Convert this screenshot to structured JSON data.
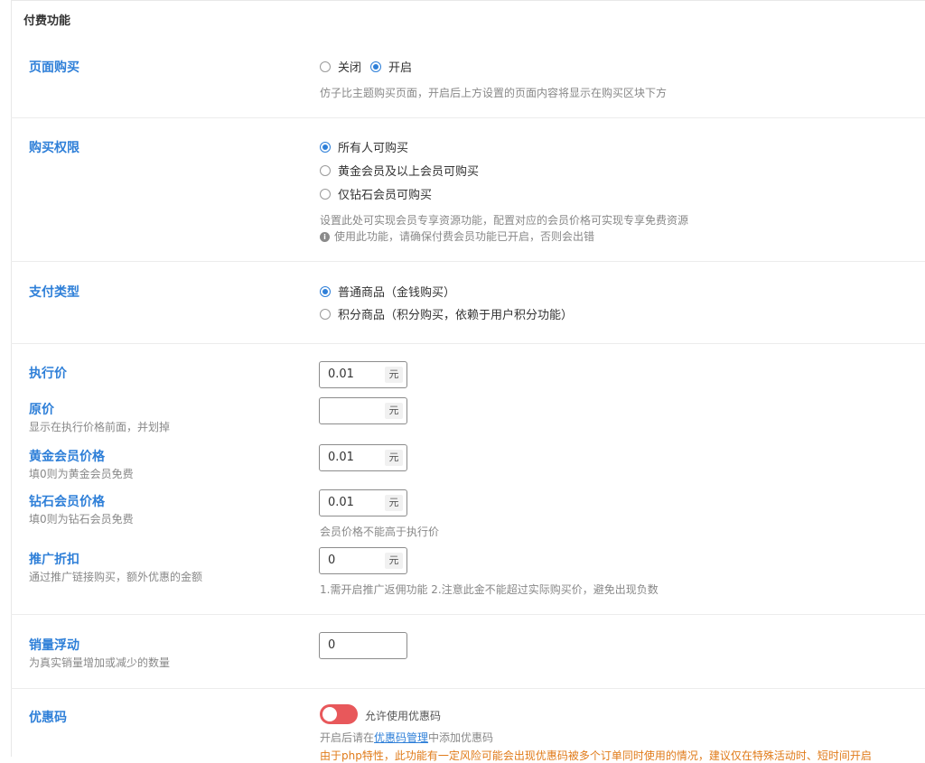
{
  "section_title": "付费功能",
  "page_purchase": {
    "label": "页面购买",
    "options": [
      "关闭",
      "开启"
    ],
    "selected": 1,
    "help": "仿子比主题购买页面，开启后上方设置的页面内容将显示在购买区块下方"
  },
  "purchase_permission": {
    "label": "购买权限",
    "options": [
      "所有人可购买",
      "黄金会员及以上会员可购买",
      "仅钻石会员可购买"
    ],
    "selected": 0,
    "help": "设置此处可实现会员专享资源功能，配置对应的会员价格可实现专享免费资源",
    "notice_icon": "info-icon",
    "notice": "使用此功能，请确保付费会员功能已开启，否则会出错"
  },
  "pay_type": {
    "label": "支付类型",
    "options": [
      "普通商品（金钱购买）",
      "积分商品（积分购买，依赖于用户积分功能）"
    ],
    "selected": 0
  },
  "price": {
    "label": "执行价",
    "value": "0.01",
    "unit": "元"
  },
  "original_price": {
    "label": "原价",
    "desc": "显示在执行价格前面，并划掉",
    "value": "",
    "unit": "元"
  },
  "gold_price": {
    "label": "黄金会员价格",
    "desc": "填0则为黄金会员免费",
    "value": "0.01",
    "unit": "元"
  },
  "diamond_price": {
    "label": "钻石会员价格",
    "desc": "填0则为钻石会员免费",
    "value": "0.01",
    "unit": "元",
    "help": "会员价格不能高于执行价"
  },
  "promo_discount": {
    "label": "推广折扣",
    "desc": "通过推广链接购买，额外优惠的金额",
    "value": "0",
    "unit": "元",
    "help": "1.需开启推广返佣功能 2.注意此金不能超过实际购买价，避免出现负数"
  },
  "sales_float": {
    "label": "销量浮动",
    "desc": "为真实销量增加或减少的数量",
    "value": "0"
  },
  "coupon": {
    "label": "优惠码",
    "toggle_label": "允许使用优惠码",
    "toggle_on": false,
    "toggle_color": "#e8585b",
    "help_prefix": "开启后请在",
    "help_link": "优惠码管理",
    "help_suffix": "中添加优惠码",
    "warning": "由于php特性，此功能有一定风险可能会出现优惠码被多个订单同时使用的情况，建议仅在特殊活动时、短时间开启"
  },
  "colors": {
    "accent": "#2e7fd8",
    "warning": "#e07b1a"
  }
}
